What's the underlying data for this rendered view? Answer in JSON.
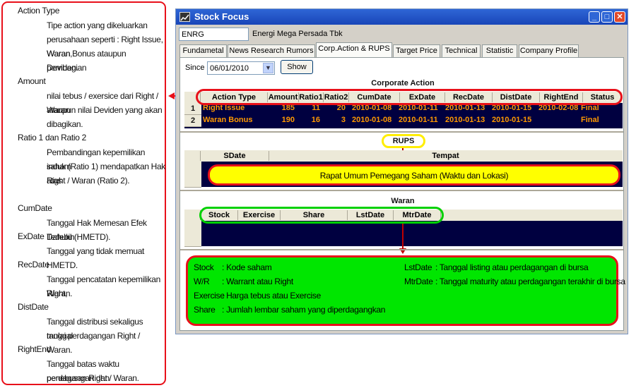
{
  "glossary": [
    {
      "term": "Action Type",
      "lines": [
        "Tipe action yang dikeluarkan",
        "perusahaan seperti : Right Issue, Waran,",
        "Waran Bonus ataupun pembagian",
        "Deviden."
      ]
    },
    {
      "term": "Amount",
      "lines": [
        "nilai tebus / exersice dari Right / Waran",
        "ataupun nilai Deviden yang akan",
        "dibagikan."
      ]
    },
    {
      "term": "Ratio 1 dan Ratio 2",
      "lines": [
        "Pembandingan kepemilikan saham",
        "induk (Ratio 1) mendapatkan Hak atas",
        "Right / Waran (Ratio 2)."
      ]
    },
    {
      "term": "CumDate",
      "lines": [
        "Tanggal Hak Memesan Efek Terlebih",
        "Dahulu (HMETD)."
      ]
    },
    {
      "term": "ExDate",
      "lines": [
        "Tanggal yang tidak memuat HMETD."
      ]
    },
    {
      "term": "RecDate",
      "lines": [
        "Tanggal pencatatan kepemilikan Right,",
        "Waran."
      ]
    },
    {
      "term": "DistDate",
      "lines": [
        "Tanggal distribusi sekaligus tanggal",
        "mulai perdagangan Right / Waran."
      ]
    },
    {
      "term": "RightEnd",
      "lines": [
        "Tanggal batas waktu perdagangan dan",
        "penebusan Right / Waran."
      ]
    }
  ],
  "window": {
    "title": "Stock Focus",
    "icon": "app-icon"
  },
  "stock": {
    "code": "ENRG",
    "name": "Energi Mega Persada Tbk"
  },
  "tabs": [
    "Fundametal",
    "News Research Rumors",
    "Corp.Action & RUPS",
    "Target Price",
    "Technical",
    "Statistic",
    "Company Profile"
  ],
  "active_tab": "Corp.Action & RUPS",
  "filter": {
    "since_label": "Since",
    "since_value": "06/01/2010",
    "show_label": "Show"
  },
  "corporate_action": {
    "title": "Corporate Action",
    "columns": [
      "Action Type",
      "Amount",
      "Ratio1",
      "Ratio2",
      "CumDate",
      "ExDate",
      "RecDate",
      "DistDate",
      "RightEnd",
      "Status"
    ],
    "rows": [
      {
        "num": "1",
        "action": "Right Issue",
        "amount": "185",
        "ratio1": "11",
        "ratio2": "20",
        "cum": "2010-01-08",
        "ex": "2010-01-11",
        "rec": "2010-01-13",
        "dist": "2010-01-15",
        "rightend": "2010-02-08",
        "status": "Final"
      },
      {
        "num": "2",
        "action": "Waran Bonus",
        "amount": "190",
        "ratio1": "16",
        "ratio2": "3",
        "cum": "2010-01-08",
        "ex": "2010-01-11",
        "rec": "2010-01-13",
        "dist": "2010-01-15",
        "rightend": "",
        "status": "Final"
      }
    ]
  },
  "rups": {
    "title": "RUPS",
    "columns": [
      "SDate",
      "Tempat"
    ],
    "note": "Rapat Umum Pemegang Saham (Waktu dan Lokasi)"
  },
  "waran": {
    "title": "Waran",
    "columns": [
      "Stock",
      "Exercise",
      "Share",
      "LstDate",
      "MtrDate"
    ]
  },
  "legend": {
    "left": [
      {
        "term": "Stock",
        "desc": ": Kode saham"
      },
      {
        "term": "W/R",
        "desc": ": Warrant atau Right"
      },
      {
        "term": "Exercise",
        "desc": ": Harga tebus atau Exercise"
      },
      {
        "term": "Share",
        "desc": ": Jumlah lembar saham yang diperdagangkan"
      }
    ],
    "right": [
      {
        "term": "LstDate",
        "desc": ": Tanggal listing atau perdagangan di bursa"
      },
      {
        "term": "MtrDate",
        "desc": ": Tanggal maturity atau perdagangan terakhir di bursa"
      }
    ]
  },
  "colors": {
    "accent_red": "#e8101a",
    "yellow": "#ffff00",
    "green": "#00e600",
    "grid_bg": "#000040",
    "row_text": "#ff9900"
  }
}
